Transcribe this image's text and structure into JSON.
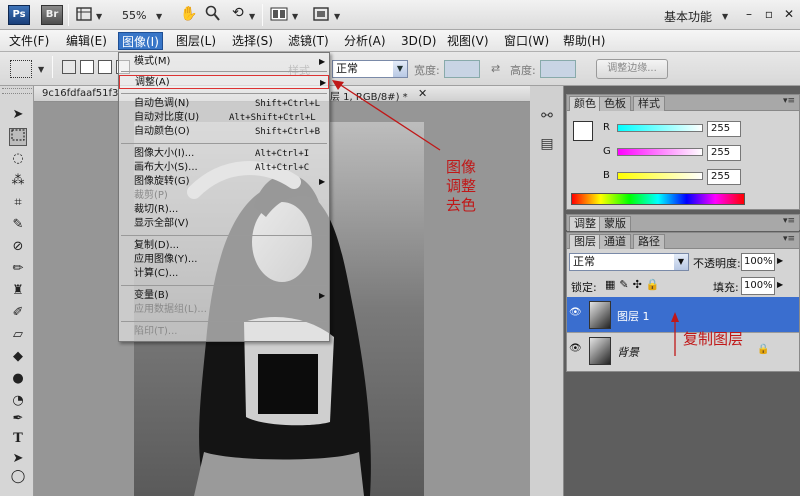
{
  "app": {
    "ps_logo": "Ps",
    "br_logo": "Br",
    "zoom": "55%",
    "workspace": "基本功能"
  },
  "menubar": [
    "文件(F)",
    "编辑(E)",
    "图像(I)",
    "图层(L)",
    "选择(S)",
    "滤镜(T)",
    "分析(A)",
    "3D(D)",
    "视图(V)",
    "窗口(W)",
    "帮助(H)"
  ],
  "options_bar": {
    "mode_value": "正常",
    "style_label": "样式",
    "width_label": "宽度:",
    "height_label": "高度:",
    "refine_label": "调整边缘..."
  },
  "document_tab": {
    "name": "9c16fdfaaf51f3",
    "info": "层 1, RGB/8#) *"
  },
  "image_menu": {
    "mode": "模式(M)",
    "adjust": "调整(A)",
    "auto_tone": "自动色调(N)",
    "auto_tone_sc": "Shift+Ctrl+L",
    "auto_contrast": "自动对比度(U)",
    "auto_contrast_sc": "Alt+Shift+Ctrl+L",
    "auto_color": "自动颜色(O)",
    "auto_color_sc": "Shift+Ctrl+B",
    "image_size": "图像大小(I)...",
    "image_size_sc": "Alt+Ctrl+I",
    "canvas_size": "画布大小(S)...",
    "canvas_size_sc": "Alt+Ctrl+C",
    "rotate": "图像旋转(G)",
    "crop": "裁剪(P)",
    "trim": "裁切(R)...",
    "reveal_all": "显示全部(V)",
    "duplicate": "复制(D)...",
    "apply_image": "应用图像(Y)...",
    "calculations": "计算(C)...",
    "variables": "变量(B)",
    "apply_dataset": "应用数据组(L)...",
    "trap": "陷印(T)..."
  },
  "color_panel": {
    "tabs": [
      "颜色",
      "色板",
      "样式"
    ],
    "r_label": "R",
    "g_label": "G",
    "b_label": "B",
    "r": "255",
    "g": "255",
    "b": "255"
  },
  "adjust_panel": {
    "tabs": [
      "调整",
      "蒙版"
    ]
  },
  "layers_panel": {
    "tabs": [
      "图层",
      "通道",
      "路径"
    ],
    "blend_mode": "正常",
    "opacity_label": "不透明度:",
    "opacity": "100%",
    "lock_label": "锁定:",
    "fill_label": "填充:",
    "fill": "100%",
    "layers": [
      {
        "name": "图层 1",
        "selected": true
      },
      {
        "name": "背景",
        "locked": true
      }
    ]
  },
  "annotations": {
    "menu_note": "图像\n调整\n去色",
    "layer_note": "复制图层"
  },
  "colors": {
    "accent": "#3a6ecf",
    "annotation": "#c01818"
  }
}
